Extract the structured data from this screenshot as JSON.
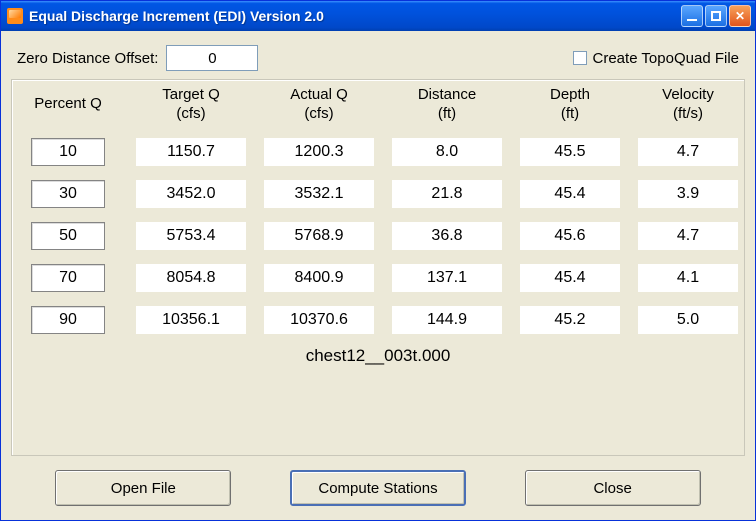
{
  "window": {
    "title": "Equal Discharge Increment (EDI) Version 2.0"
  },
  "toprow": {
    "offset_label": "Zero Distance Offset:",
    "offset_value": "0",
    "create_topo_label": "Create TopoQuad File",
    "create_topo_checked": false
  },
  "headers": {
    "percent_q": "Percent Q",
    "target_q_1": "Target Q",
    "target_q_2": "(cfs)",
    "actual_q_1": "Actual Q",
    "actual_q_2": "(cfs)",
    "distance_1": "Distance",
    "distance_2": "(ft)",
    "depth_1": "Depth",
    "depth_2": "(ft)",
    "velocity_1": "Velocity",
    "velocity_2": "(ft/s)"
  },
  "rows": [
    {
      "pq": "10",
      "tq": "1150.7",
      "aq": "1200.3",
      "dist": "8.0",
      "depth": "45.5",
      "vel": "4.7"
    },
    {
      "pq": "30",
      "tq": "3452.0",
      "aq": "3532.1",
      "dist": "21.8",
      "depth": "45.4",
      "vel": "3.9"
    },
    {
      "pq": "50",
      "tq": "5753.4",
      "aq": "5768.9",
      "dist": "36.8",
      "depth": "45.6",
      "vel": "4.7"
    },
    {
      "pq": "70",
      "tq": "8054.8",
      "aq": "8400.9",
      "dist": "137.1",
      "depth": "45.4",
      "vel": "4.1"
    },
    {
      "pq": "90",
      "tq": "10356.1",
      "aq": "10370.6",
      "dist": "144.9",
      "depth": "45.2",
      "vel": "5.0"
    }
  ],
  "filename": "chest12__003t.000",
  "buttons": {
    "open_file": "Open File",
    "compute": "Compute Stations",
    "close": "Close"
  }
}
